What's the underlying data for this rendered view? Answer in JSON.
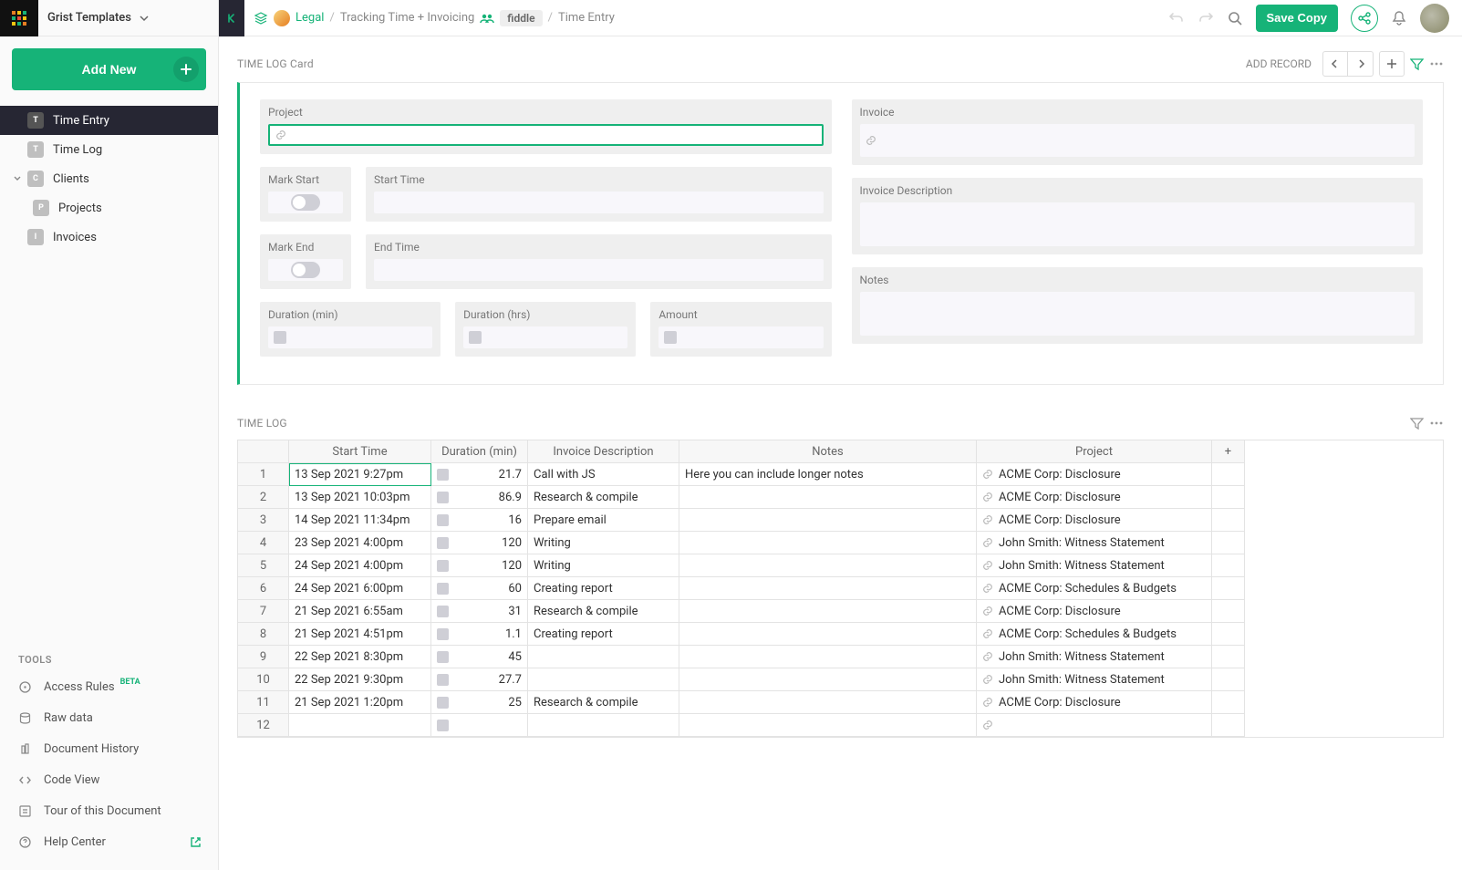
{
  "org": {
    "name": "Grist Templates"
  },
  "breadcrumb": {
    "team": "Legal",
    "doc": "Tracking Time + Invoicing",
    "badge": "fiddle",
    "page": "Time Entry"
  },
  "topbar": {
    "save_copy": "Save Copy"
  },
  "add_new_label": "Add New",
  "nav": [
    {
      "icon": "T",
      "label": "Time Entry",
      "active": true,
      "indent": false
    },
    {
      "icon": "T",
      "label": "Time Log",
      "active": false,
      "indent": false
    },
    {
      "icon": "C",
      "label": "Clients",
      "active": false,
      "indent": false,
      "expand": true
    },
    {
      "icon": "P",
      "label": "Projects",
      "active": false,
      "indent": true
    },
    {
      "icon": "I",
      "label": "Invoices",
      "active": false,
      "indent": false
    }
  ],
  "tools_head": "TOOLS",
  "tools": [
    {
      "label": "Access Rules",
      "beta": true
    },
    {
      "label": "Raw data"
    },
    {
      "label": "Document History"
    },
    {
      "label": "Code View"
    },
    {
      "label": "Tour of this Document"
    },
    {
      "label": "Help Center",
      "ext": true
    }
  ],
  "card": {
    "title": "TIME LOG Card",
    "add_record": "ADD RECORD",
    "fields": {
      "project": "Project",
      "invoice": "Invoice",
      "mark_start": "Mark Start",
      "start_time": "Start Time",
      "mark_end": "Mark End",
      "end_time": "End Time",
      "invoice_desc": "Invoice Description",
      "duration_min": "Duration (min)",
      "duration_hrs": "Duration (hrs)",
      "amount": "Amount",
      "notes": "Notes"
    }
  },
  "grid": {
    "title": "TIME LOG",
    "columns": [
      "Start Time",
      "Duration (min)",
      "Invoice Description",
      "Notes",
      "Project"
    ],
    "rows": [
      {
        "n": 1,
        "start": "13 Sep 2021 9:27pm",
        "dur": "21.7",
        "desc": "Call with JS",
        "notes": "Here you can include longer notes",
        "project": "ACME Corp: Disclosure"
      },
      {
        "n": 2,
        "start": "13 Sep 2021 10:03pm",
        "dur": "86.9",
        "desc": "Research & compile",
        "notes": "",
        "project": "ACME Corp: Disclosure"
      },
      {
        "n": 3,
        "start": "14 Sep 2021 11:34pm",
        "dur": "16",
        "desc": "Prepare email",
        "notes": "",
        "project": "ACME Corp: Disclosure"
      },
      {
        "n": 4,
        "start": "23 Sep 2021 4:00pm",
        "dur": "120",
        "desc": "Writing",
        "notes": "",
        "project": "John Smith: Witness Statement"
      },
      {
        "n": 5,
        "start": "24 Sep 2021 4:00pm",
        "dur": "120",
        "desc": "Writing",
        "notes": "",
        "project": "John Smith: Witness Statement"
      },
      {
        "n": 6,
        "start": "24 Sep 2021 6:00pm",
        "dur": "60",
        "desc": "Creating report",
        "notes": "",
        "project": "ACME Corp: Schedules & Budgets"
      },
      {
        "n": 7,
        "start": "21 Sep 2021 6:55am",
        "dur": "31",
        "desc": "Research & compile",
        "notes": "",
        "project": "ACME Corp: Disclosure"
      },
      {
        "n": 8,
        "start": "21 Sep 2021 4:51pm",
        "dur": "1.1",
        "desc": "Creating report",
        "notes": "",
        "project": "ACME Corp: Schedules & Budgets"
      },
      {
        "n": 9,
        "start": "22 Sep 2021 8:30pm",
        "dur": "45",
        "desc": "",
        "notes": "",
        "project": "John Smith: Witness Statement"
      },
      {
        "n": 10,
        "start": "22 Sep 2021 9:30pm",
        "dur": "27.7",
        "desc": "",
        "notes": "",
        "project": "John Smith: Witness Statement"
      },
      {
        "n": 11,
        "start": "21 Sep 2021 1:20pm",
        "dur": "25",
        "desc": "Research & compile",
        "notes": "",
        "project": "ACME Corp: Disclosure"
      },
      {
        "n": 12,
        "start": "",
        "dur": "",
        "desc": "",
        "notes": "",
        "project": ""
      }
    ]
  }
}
